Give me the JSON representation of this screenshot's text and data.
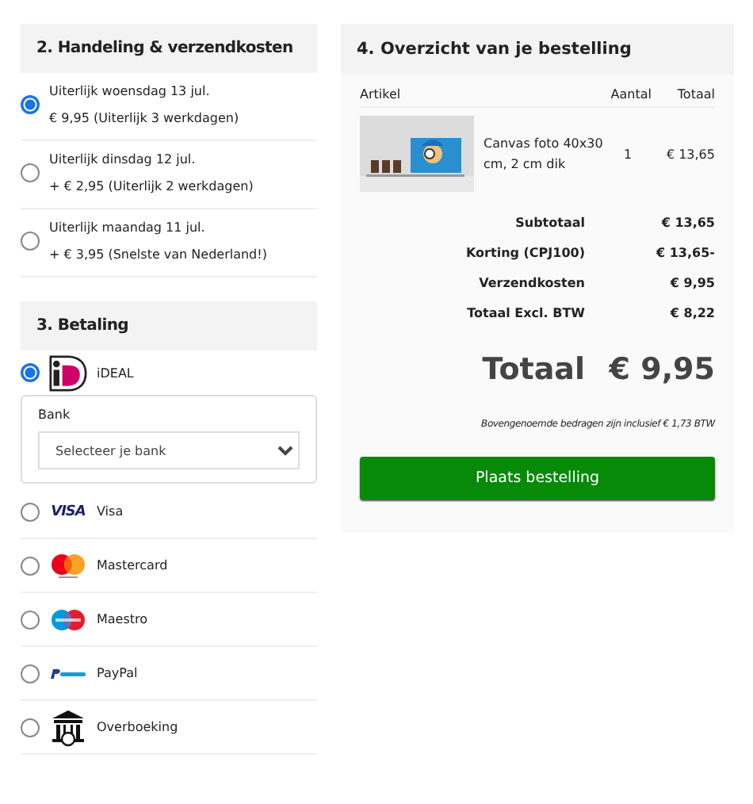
{
  "shipping": {
    "title": "2. Handeling & verzendkosten",
    "options": [
      {
        "label": "Uiterlijk woensdag 13 jul.",
        "detail": "€ 9,95 (Uiterlijk 3 werkdagen)",
        "selected": true
      },
      {
        "label": "Uiterlijk dinsdag 12 jul.",
        "detail": "+ € 2,95 (Uiterlijk 2 werkdagen)",
        "selected": false
      },
      {
        "label": "Uiterlijk maandag 11 jul.",
        "detail": "+ € 3,95 (Snelste van Nederland!)",
        "selected": false
      }
    ]
  },
  "payment": {
    "title": "3. Betaling",
    "methods": [
      {
        "kind": "ideal",
        "label": "iDEAL",
        "selected": true,
        "bank": {
          "label": "Bank",
          "placeholder": "Selecteer je bank"
        }
      },
      {
        "kind": "visa",
        "logo_text": "VISA",
        "label": "Visa",
        "selected": false
      },
      {
        "kind": "mastercard",
        "label": "Mastercard",
        "selected": false
      },
      {
        "kind": "maestro",
        "label": "Maestro",
        "selected": false
      },
      {
        "kind": "paypal",
        "label": "PayPal",
        "selected": false
      },
      {
        "kind": "bank",
        "label": "Overboeking",
        "selected": false
      }
    ]
  },
  "overview": {
    "title": "4. Overzicht van je bestelling",
    "columns": [
      "Artikel",
      "Aantal",
      "Totaal"
    ],
    "items": [
      {
        "name": "Canvas foto 40x30 cm, 2 cm dik",
        "quantity": "1",
        "total": "€ 13,65"
      }
    ],
    "summary": [
      {
        "label": "Subtotaal",
        "value": "€ 13,65"
      },
      {
        "label": "Korting (CPJ100)",
        "value": "€ 13,65-"
      },
      {
        "label": "Verzendkosten",
        "value": "€ 9,95"
      },
      {
        "label": "Totaal Excl. BTW",
        "value": "€ 8,22"
      }
    ],
    "total": {
      "label": "Totaal",
      "value": "€ 9,95"
    },
    "note": "Bovengenoemde bedragen zijn inclusief € 1,73 BTW",
    "button": "Plaats bestelling"
  }
}
